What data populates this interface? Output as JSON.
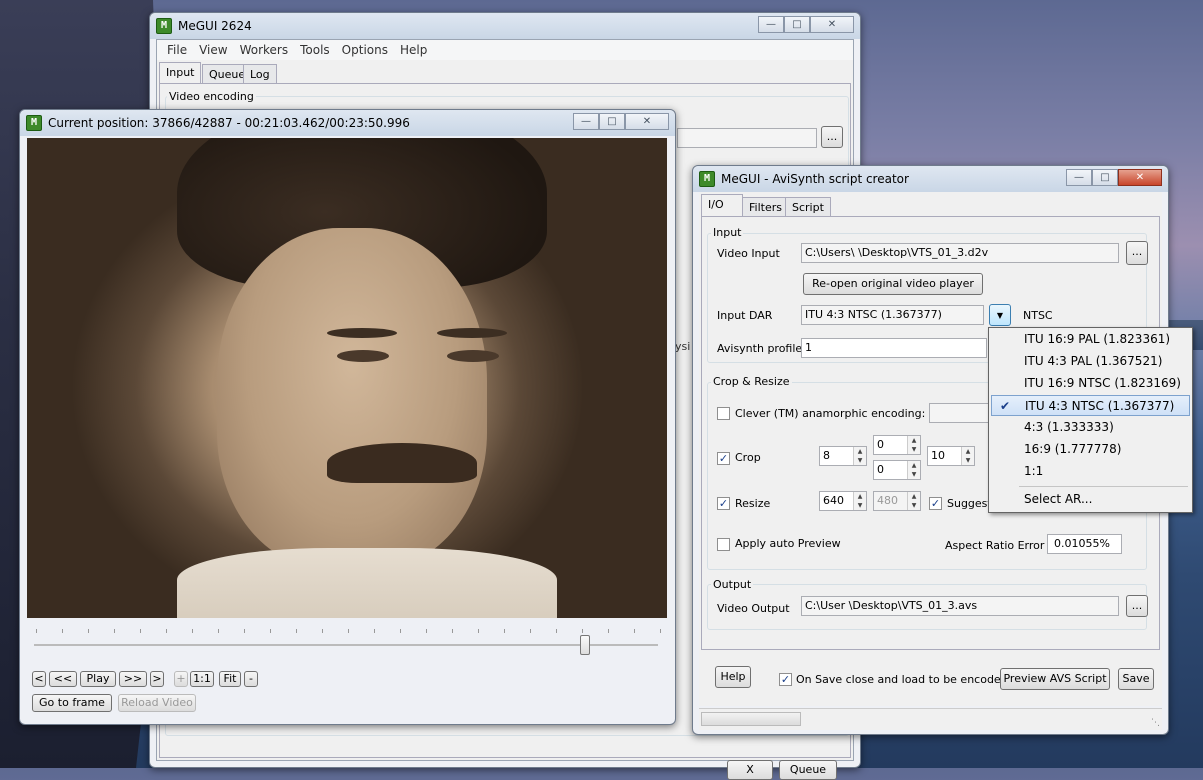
{
  "main_window": {
    "title": "MeGUI 2624",
    "menu": [
      "File",
      "View",
      "Workers",
      "Tools",
      "Options",
      "Help"
    ],
    "tabs": [
      "Input",
      "Queue",
      "Log"
    ],
    "group_video_encoding": "Video encoding",
    "browse_label": "...",
    "partial_text": "ysi",
    "bottom_buttons": {
      "x_label": "X",
      "queue_label": "Queue"
    }
  },
  "preview_window": {
    "title": "Current position: 37866/42887   -   00:21:03.462/00:23:50.996",
    "buttons": {
      "prev": "<",
      "rew": "<<",
      "play": "Play",
      "ffw": ">>",
      "next": ">",
      "plus": "+",
      "one_to_one": "1:1",
      "fit": "Fit",
      "minus": "-",
      "goto": "Go to frame",
      "reload": "Reload Video"
    },
    "slider_position": 0.883
  },
  "avs_window": {
    "title": "MeGUI - AviSynth script creator",
    "tabs": [
      "I/O",
      "Filters",
      "Script"
    ],
    "input_group": "Input",
    "video_input_label": "Video Input",
    "video_input_value": "C:\\Users\\ \\Desktop\\VTS_01_3.d2v",
    "browse_label": "...",
    "reopen_label": "Re-open original video player",
    "input_dar_label": "Input DAR",
    "input_dar_value": "ITU 4:3 NTSC (1.367377)",
    "ntsc_label": "NTSC",
    "avisynth_profile_label": "Avisynth profile",
    "avisynth_profile_value": "1",
    "crop_group": "Crop & Resize",
    "clever_label": "Clever (TM) anamorphic encoding:",
    "crop_label": "Crop",
    "crop_left": "8",
    "crop_top": "0",
    "crop_bottom": "0",
    "crop_right": "10",
    "resize_label": "Resize",
    "resize_width": "640",
    "resize_height": "480",
    "suggest_label": "Suggest",
    "auto_preview_label": "Apply auto Preview",
    "ar_error_label": "Aspect Ratio Error",
    "ar_error_value": "0.01055%",
    "output_group": "Output",
    "video_output_label": "Video Output",
    "video_output_value": "C:\\User \\Desktop\\VTS_01_3.avs",
    "help_label": "Help",
    "on_save_label": "On Save close and load to be encoded",
    "preview_avs_label": "Preview AVS Script",
    "save_label": "Save"
  },
  "dar_dropdown": {
    "items": [
      "ITU 16:9 PAL (1.823361)",
      "ITU 4:3 PAL (1.367521)",
      "ITU 16:9 NTSC (1.823169)",
      "ITU 4:3 NTSC (1.367377)",
      "4:3 (1.333333)",
      "16:9 (1.777778)",
      "1:1",
      "Select AR..."
    ],
    "selected_index": 3
  },
  "colors": {
    "selection": "#cfe1f7",
    "title_bar": "#c9d6e6",
    "app_icon": "#3e8a2a"
  }
}
